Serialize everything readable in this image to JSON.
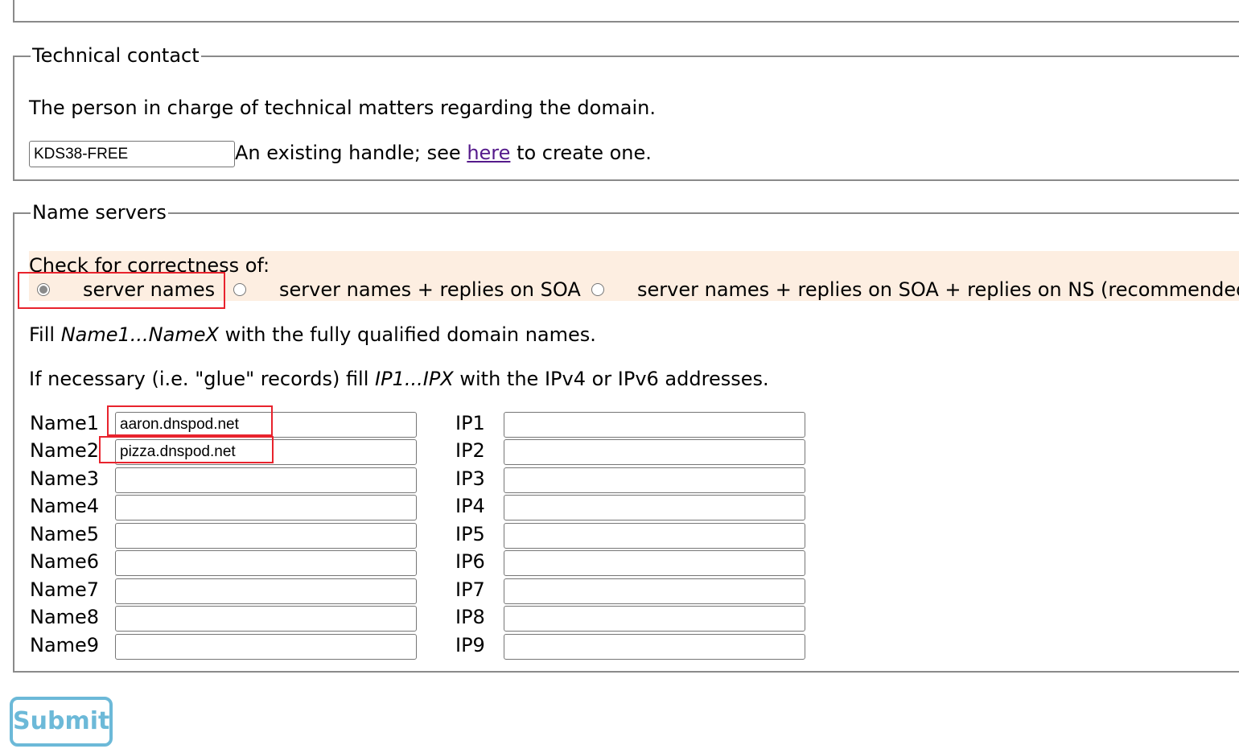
{
  "technical_contact": {
    "legend": "Technical contact",
    "description": "The person in charge of technical matters regarding the domain.",
    "handle_value": "KDS38-FREE",
    "handle_hint_prefix": "An existing handle; see",
    "handle_hint_link": "here",
    "handle_hint_suffix": "to create one."
  },
  "name_servers": {
    "legend": "Name servers",
    "check_label": "Check for correctness of:",
    "options": [
      {
        "label": "server names",
        "selected": true
      },
      {
        "label": "server names + replies on SOA",
        "selected": false
      },
      {
        "label": "server names + replies on SOA + replies on NS (recommended)",
        "selected": false
      }
    ],
    "fill_prefix": "Fill",
    "fill_italic": "Name1...NameX",
    "fill_suffix": "with the fully qualified domain names.",
    "glue_prefix": "If necessary (i.e. \"glue\" records) fill",
    "glue_italic": "IP1...IPX",
    "glue_suffix": "with the IPv4 or IPv6 addresses.",
    "rows": [
      {
        "name_label": "Name1",
        "name_value": "aaron.dnspod.net",
        "ip_label": "IP1",
        "ip_value": ""
      },
      {
        "name_label": "Name2",
        "name_value": "pizza.dnspod.net",
        "ip_label": "IP2",
        "ip_value": ""
      },
      {
        "name_label": "Name3",
        "name_value": "",
        "ip_label": "IP3",
        "ip_value": ""
      },
      {
        "name_label": "Name4",
        "name_value": "",
        "ip_label": "IP4",
        "ip_value": ""
      },
      {
        "name_label": "Name5",
        "name_value": "",
        "ip_label": "IP5",
        "ip_value": ""
      },
      {
        "name_label": "Name6",
        "name_value": "",
        "ip_label": "IP6",
        "ip_value": ""
      },
      {
        "name_label": "Name7",
        "name_value": "",
        "ip_label": "IP7",
        "ip_value": ""
      },
      {
        "name_label": "Name8",
        "name_value": "",
        "ip_label": "IP8",
        "ip_value": ""
      },
      {
        "name_label": "Name9",
        "name_value": "",
        "ip_label": "IP9",
        "ip_value": ""
      }
    ]
  },
  "submit_label": "Submit",
  "colors": {
    "highlight": "#e8232d",
    "check_band": "#fdeee1",
    "submit_accent": "#6cb9d8",
    "visited_link": "#551a8b"
  }
}
